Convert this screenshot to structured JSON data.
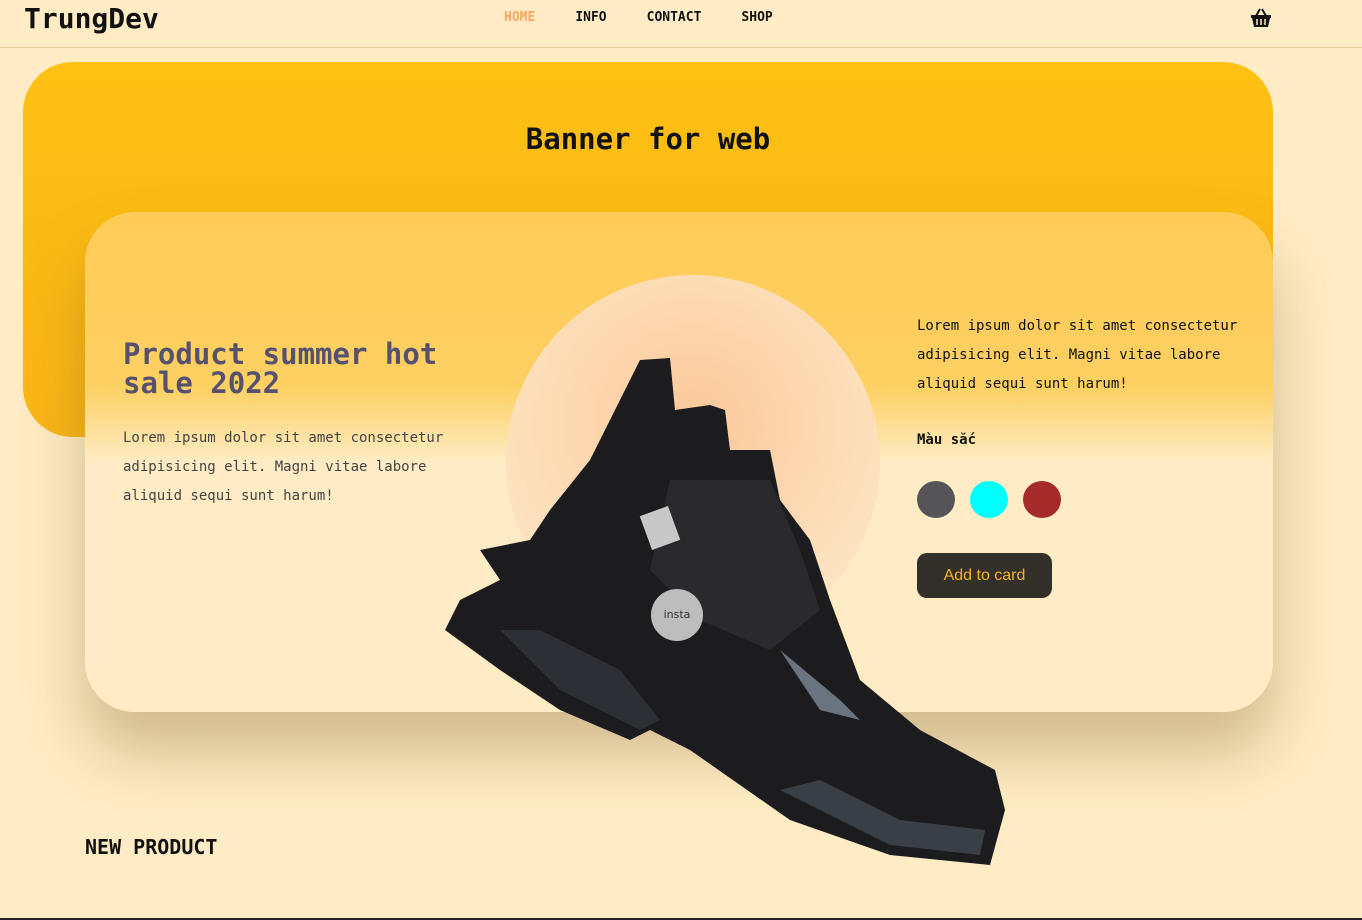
{
  "header": {
    "logo": "TrungDev",
    "nav": [
      {
        "label": "HOME",
        "active": true
      },
      {
        "label": "INFO"
      },
      {
        "label": "CONTACT"
      },
      {
        "label": "SHOP"
      }
    ],
    "cart_icon": "basket-icon"
  },
  "banner": {
    "title": "Banner for web"
  },
  "product": {
    "title": "Product summer hot sale 2022",
    "description": "Lorem ipsum dolor sit amet consectetur adipisicing elit. Magni vitae labore aliquid sequi sunt harum!",
    "side_text": "Lorem ipsum dolor sit amet consectetur adipisicing elit. Magni vitae labore aliquid sequi sunt harum!",
    "color_label": "Màu sắc",
    "colors": [
      "#555458",
      "#00ffff",
      "#a52a2a"
    ],
    "button": "Add to card",
    "image": "black-sneaker-image"
  },
  "section": {
    "title": "NEW PRODUCT"
  }
}
